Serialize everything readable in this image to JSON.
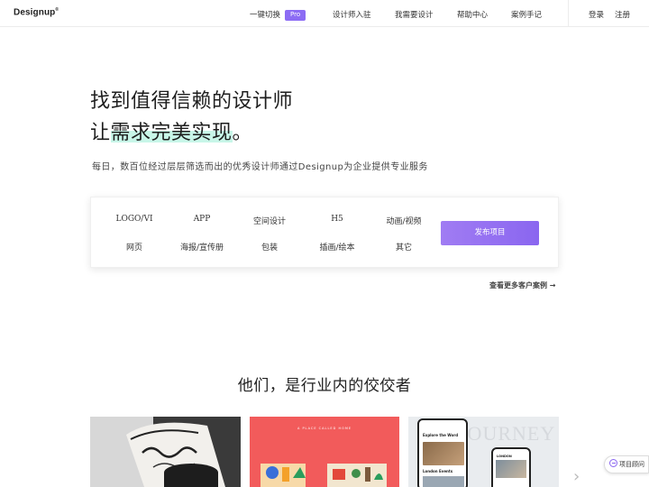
{
  "header": {
    "logo": "Designup",
    "logo_mark": "®",
    "switch_label": "一键切换",
    "pro_badge": "Pro",
    "nav": [
      "设计师入驻",
      "我需要设计",
      "帮助中心",
      "案例手记"
    ],
    "login": "登录",
    "register": "注册"
  },
  "hero": {
    "line1": "找到值得信赖的设计师",
    "line2_prefix": "让",
    "line2_highlight": "需求完美实现",
    "line2_suffix": "。",
    "subtitle": "每日，数百位经过层层筛选而出的优秀设计师通过Designup为企业提供专业服务"
  },
  "categories": {
    "row1": [
      "LOGO/VI",
      "APP",
      "空间设计",
      "H5",
      "动画/视频"
    ],
    "row2": [
      "网页",
      "海报/宣传册",
      "包装",
      "插画/绘本",
      "其它"
    ],
    "publish_button": "发布项目"
  },
  "more_cases": "查看更多客户案例 →",
  "section": {
    "title": "他们，是行业内的佼佼者"
  },
  "thumbnails": {
    "t2_caption": "A PLACE CALLED HOME",
    "t3_overlay": "JOURNEY",
    "t3_phone1_title": "Explore the Word",
    "t3_phone1_sub": "London Events",
    "t3_phone2_title": "LONDON"
  },
  "chat": {
    "label": "项目顾问"
  },
  "colors": {
    "accent": "#8c6cf4",
    "highlight": "#c8f6e8",
    "thumb2_bg": "#f25b5b"
  }
}
